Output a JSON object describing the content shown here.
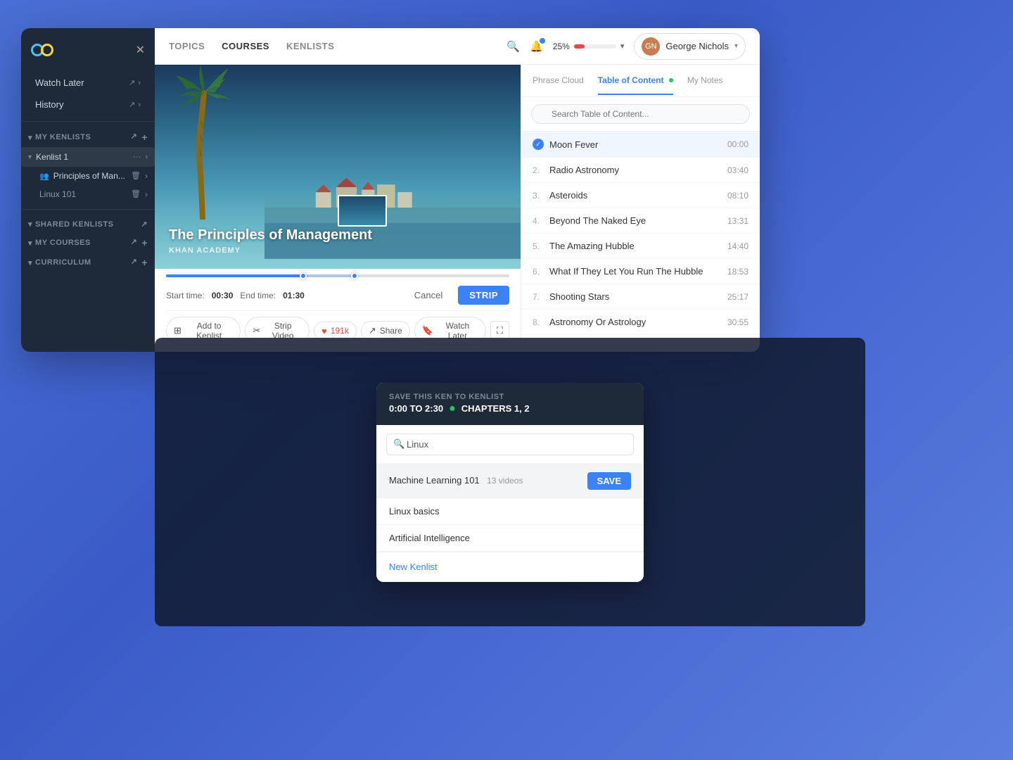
{
  "app": {
    "logo_alt": "Kensho Logo",
    "close_label": "×"
  },
  "sidebar": {
    "nav_items": [
      {
        "label": "Watch Later",
        "id": "watch-later"
      },
      {
        "label": "History",
        "id": "history"
      }
    ],
    "sections": [
      {
        "id": "my-kenlists",
        "label": "MY KENLISTS",
        "items": [
          {
            "label": "Kenlist 1",
            "subitems": [
              {
                "label": "Principles of Man...",
                "active": true
              },
              {
                "label": "Linux 101"
              }
            ]
          }
        ]
      },
      {
        "id": "shared-kenlists",
        "label": "SHARED KENLISTS",
        "items": []
      },
      {
        "id": "my-courses",
        "label": "MY COURSES",
        "items": []
      },
      {
        "id": "curriculum",
        "label": "CURRICULUM",
        "items": []
      }
    ]
  },
  "topnav": {
    "links": [
      {
        "label": "TOPICS",
        "active": false
      },
      {
        "label": "COURSES",
        "active": false
      },
      {
        "label": "KENLISTS",
        "active": false
      }
    ],
    "progress": {
      "value": "25%",
      "percent": 25
    },
    "user": {
      "name": "George Nichols",
      "initials": "GN"
    }
  },
  "video": {
    "title": "The Principles of Management",
    "source": "KHAN ACADEMY"
  },
  "controls": {
    "start_time_label": "Start time:",
    "start_time": "00:30",
    "end_time_label": "End time:",
    "end_time": "01:30",
    "cancel_label": "Cancel",
    "strip_label": "STRIP"
  },
  "actions": [
    {
      "label": "Add to Kenlist",
      "icon": "📋"
    },
    {
      "label": "Strip Video",
      "icon": "✂"
    },
    {
      "label": "191k",
      "icon": "♥"
    },
    {
      "label": "Share",
      "icon": "↗"
    },
    {
      "label": "Watch Later",
      "icon": "🔖"
    }
  ],
  "panel": {
    "tabs": [
      {
        "label": "Phrase Cloud",
        "active": false,
        "dot": false
      },
      {
        "label": "Table of Content",
        "active": true,
        "dot": true
      },
      {
        "label": "My Notes",
        "active": false,
        "dot": false
      }
    ],
    "search_placeholder": "Search Table of Content...",
    "toc": [
      {
        "num": "",
        "check": true,
        "title": "Moon Fever",
        "time": "00:00"
      },
      {
        "num": "2.",
        "check": false,
        "title": "Radio Astronomy",
        "time": "03:40"
      },
      {
        "num": "3.",
        "check": false,
        "title": "Asteroids",
        "time": "08:10"
      },
      {
        "num": "4.",
        "check": false,
        "title": "Beyond The Naked Eye",
        "time": "13:31"
      },
      {
        "num": "5.",
        "check": false,
        "title": "The Amazing Hubble",
        "time": "14:40"
      },
      {
        "num": "6.",
        "check": false,
        "title": "What If They Let You Run The Hubble",
        "time": "18:53"
      },
      {
        "num": "7.",
        "check": false,
        "title": "Shooting Stars",
        "time": "25:17"
      },
      {
        "num": "8.",
        "check": false,
        "title": "Astronomy Or Astrology",
        "time": "30:55"
      }
    ]
  },
  "modal": {
    "save_label": "SAVE THIS KEN TO KENLIST",
    "time_range": "0:00 TO 2:30",
    "chapters": "CHAPTERS 1, 2",
    "search_value": "Linux",
    "search_placeholder": "Linux",
    "kenlists": [
      {
        "name": "Machine Learning 101",
        "count": "13 videos",
        "highlighted": true
      },
      {
        "name": "Linux basics",
        "count": "",
        "highlighted": false
      },
      {
        "name": "Artificial Intelligence",
        "count": "",
        "highlighted": false
      }
    ],
    "save_label_btn": "SAVE",
    "new_kenlist_label": "New Kenlist"
  }
}
